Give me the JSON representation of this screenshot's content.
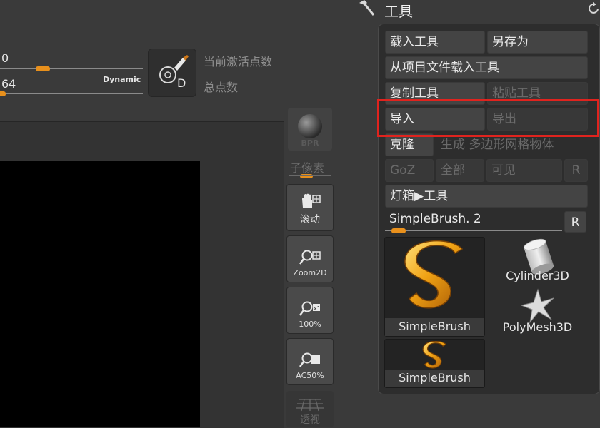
{
  "sliders": [
    {
      "value": "0",
      "thumb_fraction": 0.26
    },
    {
      "value": "64",
      "thumb_fraction": 0.0
    }
  ],
  "dynamic_label": "Dynamic",
  "dyn_button_letter": "D",
  "labels": {
    "active_points": "当前激活点数",
    "total_points": "总点数"
  },
  "strip": {
    "bpr": "BPR",
    "subpixel": "子像素",
    "scroll": "滚动",
    "zoom2d": "Zoom2D",
    "hundred": "100%",
    "ac50": "AC50%",
    "perspective": "透视"
  },
  "panel": {
    "title": "工具",
    "load_tool": "载入工具",
    "save_as": "另存为",
    "load_from_project": "从项目文件载入工具",
    "copy_tool": "复制工具",
    "paste_tool": "粘贴工具",
    "import": "导入",
    "export": "导出",
    "clone": "克隆",
    "make_polymesh": "生成 多边形网格物体",
    "goz": "GoZ",
    "all": "全部",
    "visible": "可见",
    "r": "R",
    "lightbox_tools": "灯箱▶工具",
    "current_tool": "SimpleBrush. 2",
    "current_tool_slider_fraction": 0.08,
    "thumbs": [
      {
        "name": "SimpleBrush"
      },
      {
        "name": "Cylinder3D"
      },
      {
        "name": "PolyMesh3D"
      },
      {
        "name": "SimpleBrush"
      }
    ]
  },
  "colors": {
    "accent": "#e8901c",
    "highlight": "#e0231e"
  }
}
